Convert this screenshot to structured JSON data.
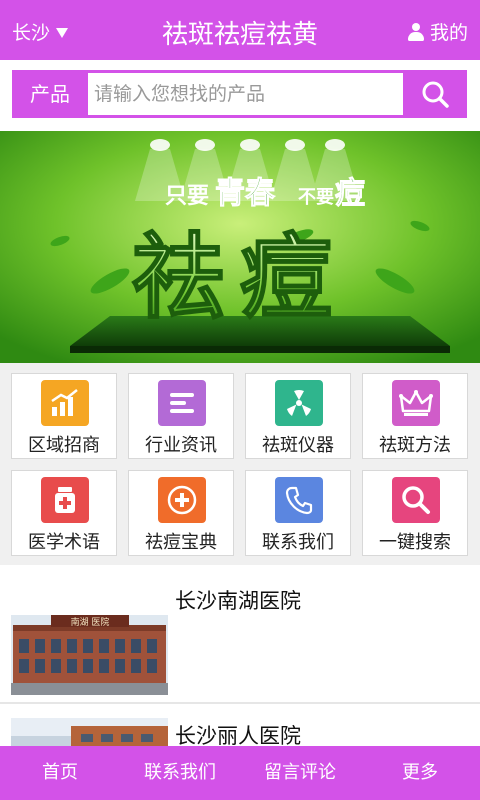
{
  "header": {
    "city": "长沙",
    "title": "祛斑祛痘祛黄",
    "mine": "我的"
  },
  "search": {
    "label": "产品",
    "placeholder": "请输入您想找的产品"
  },
  "banner": {
    "line1_a": "只要",
    "line1_b": "青春",
    "line1_c": "不要",
    "line1_d": "痘",
    "big_text": "祛痘"
  },
  "grid": [
    {
      "label": "区域招商",
      "icon": "bar-chart-icon",
      "color": "#f5a623"
    },
    {
      "label": "行业资讯",
      "icon": "news-lines-icon",
      "color": "#b36ad6"
    },
    {
      "label": "祛斑仪器",
      "icon": "fan-icon",
      "color": "#2fb58d"
    },
    {
      "label": "祛斑方法",
      "icon": "crown-icon",
      "color": "#d05cc9"
    },
    {
      "label": "医学术语",
      "icon": "medicine-bottle-icon",
      "color": "#e84c4c"
    },
    {
      "label": "祛痘宝典",
      "icon": "plus-circle-icon",
      "color": "#f06c2a"
    },
    {
      "label": "联系我们",
      "icon": "phone-icon",
      "color": "#5b86e0"
    },
    {
      "label": "一键搜索",
      "icon": "search-icon",
      "color": "#e6457e"
    }
  ],
  "listings": [
    {
      "name": "长沙南湖医院",
      "sign": "南湖  医院"
    },
    {
      "name": "长沙丽人医院"
    }
  ],
  "tabs": [
    {
      "label": "首页"
    },
    {
      "label": "联系我们"
    },
    {
      "label": "留言评论"
    },
    {
      "label": "更多"
    }
  ]
}
